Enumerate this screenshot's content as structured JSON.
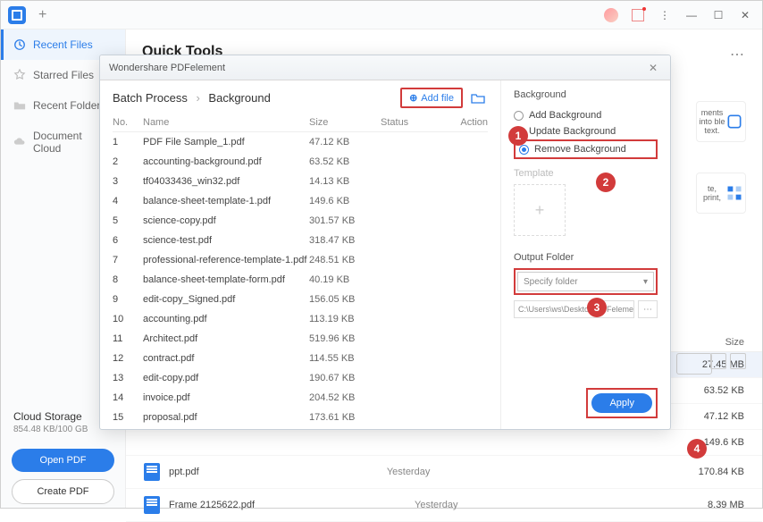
{
  "titlebar": {
    "min": "—",
    "max": "☐",
    "close": "✕"
  },
  "sidebar": {
    "items": [
      {
        "label": "Recent Files"
      },
      {
        "label": "Starred Files"
      },
      {
        "label": "Recent Folders"
      },
      {
        "label": "Document Cloud"
      }
    ],
    "cloud_label": "Cloud Storage",
    "cloud_usage": "854.48 KB/100 GB",
    "open_btn": "Open PDF",
    "create_btn": "Create PDF"
  },
  "page": {
    "title": "Quick Tools"
  },
  "bg_cards": {
    "ocr_hint": "ments into ble text.",
    "print_hint": "te, print,"
  },
  "bg_header": {
    "size": "Size"
  },
  "bg_files": [
    {
      "name": "",
      "date": "",
      "size": "27.45 MB",
      "selected": true
    },
    {
      "name": "",
      "date": "",
      "size": "63.52 KB"
    },
    {
      "name": "",
      "date": "",
      "size": "47.12 KB"
    },
    {
      "name": "",
      "date": "",
      "size": "149.6 KB"
    },
    {
      "name": "",
      "date": "",
      "size": "170.84 KB"
    },
    {
      "name": "ppt.pdf",
      "date": "Yesterday",
      "size": ""
    },
    {
      "name": "Frame 2125622.pdf",
      "date": "Yesterday",
      "size": "8.39 MB"
    }
  ],
  "modal": {
    "title": "Wondershare PDFelement",
    "breadcrumb_root": "Batch Process",
    "breadcrumb_leaf": "Background",
    "add_file": "Add file",
    "table_head": {
      "no": "No.",
      "name": "Name",
      "size": "Size",
      "status": "Status",
      "action": "Action"
    },
    "rows": [
      {
        "no": "1",
        "name": "PDF File Sample_1.pdf",
        "size": "47.12 KB"
      },
      {
        "no": "2",
        "name": "accounting-background.pdf",
        "size": "63.52 KB"
      },
      {
        "no": "3",
        "name": "tf04033436_win32.pdf",
        "size": "14.13 KB"
      },
      {
        "no": "4",
        "name": "balance-sheet-template-1.pdf",
        "size": "149.6 KB"
      },
      {
        "no": "5",
        "name": "science-copy.pdf",
        "size": "301.57 KB"
      },
      {
        "no": "6",
        "name": "science-test.pdf",
        "size": "318.47 KB"
      },
      {
        "no": "7",
        "name": "professional-reference-template-1.pdf",
        "size": "248.51 KB"
      },
      {
        "no": "8",
        "name": "balance-sheet-template-form.pdf",
        "size": "40.19 KB"
      },
      {
        "no": "9",
        "name": "edit-copy_Signed.pdf",
        "size": "156.05 KB"
      },
      {
        "no": "10",
        "name": "accounting.pdf",
        "size": "113.19 KB"
      },
      {
        "no": "11",
        "name": "Architect.pdf",
        "size": "519.96 KB"
      },
      {
        "no": "12",
        "name": "contract.pdf",
        "size": "114.55 KB"
      },
      {
        "no": "13",
        "name": "edit-copy.pdf",
        "size": "190.67 KB"
      },
      {
        "no": "14",
        "name": "invoice.pdf",
        "size": "204.52 KB"
      },
      {
        "no": "15",
        "name": "proposal.pdf",
        "size": "173.61 KB"
      }
    ],
    "panel": {
      "heading": "Background",
      "options": [
        {
          "label": "Add Background",
          "checked": false
        },
        {
          "label": "Update Background",
          "checked": false
        },
        {
          "label": "Remove Background",
          "checked": true
        }
      ],
      "template_label": "Template",
      "output_label": "Output Folder",
      "output_select": "Specify folder",
      "output_path": "C:\\Users\\ws\\Desktop\\PDFelement\\Bacl",
      "apply": "Apply"
    }
  },
  "annotations": {
    "a1": "1",
    "a2": "2",
    "a3": "3",
    "a4": "4"
  }
}
